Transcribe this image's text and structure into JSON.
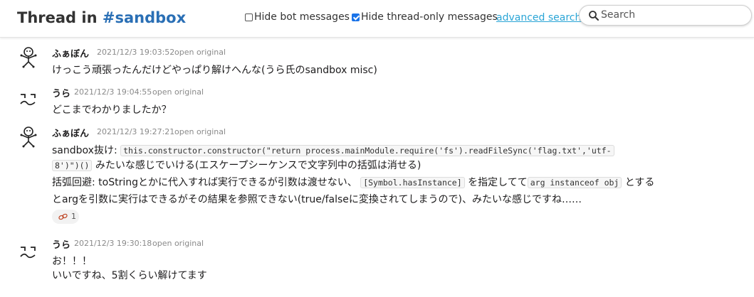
{
  "header": {
    "title_prefix": "Thread in ",
    "channel": "#sandbox",
    "hide_bot": {
      "label": "Hide bot messages",
      "checked": false
    },
    "hide_thread": {
      "label": "Hide thread-only messages",
      "checked": true
    },
    "advanced_search": "advanced search",
    "search_placeholder": "Search"
  },
  "colors": {
    "accent": "#2a6fb5",
    "link": "#2aa5d6",
    "checkbox": "#1a73e8"
  },
  "messages": [
    {
      "user": "ふぁぼん",
      "time": "2021/12/3 19:03:52",
      "open": "open original",
      "line1": "けっこう頑張ったんだけどやっぱり解けへんな(うら氏のsandbox misc)"
    },
    {
      "user": "うら",
      "time": "2021/12/3 19:04:55",
      "open": "open original",
      "line1": "どこまでわかりましたか？"
    },
    {
      "user": "ふぁぼん",
      "time": "2021/12/3 19:27:21",
      "open": "open original",
      "l1_text": "sandbox抜け: ",
      "l1_code": "this.constructor.constructor(\"return process.mainModule.require('fs').readFileSync('flag.txt','utf-",
      "l2_code": "8')\")()",
      "l2_text": " みたいな感じでいける(エスケープシーケンスで文字列中の括弧は消せる)",
      "l3_a": "括弧回避: toStringとかに代入すれば実行できるが引数は渡せない、",
      "l3_code1": "[Symbol.hasInstance]",
      "l3_b": "を指定してて",
      "l3_code2": "arg instanceof obj",
      "l3_c": " とする",
      "l4": "とargを引数に実行はできるがその結果を参照できない(true/falseに変換されてしまうので)、みたいな感じですね……",
      "reaction": {
        "icon": "eyes-emoji-icon",
        "count": "1"
      }
    },
    {
      "user": "うら",
      "time": "2021/12/3 19:30:18",
      "open": "open original",
      "line1": "お！！！",
      "line2": "いいですね、5割くらい解けてます"
    }
  ]
}
